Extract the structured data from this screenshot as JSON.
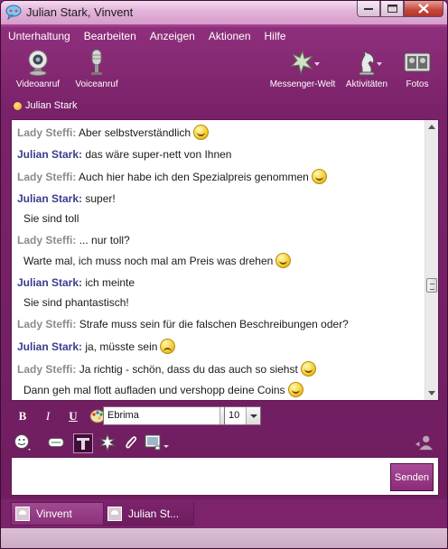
{
  "window": {
    "title": "Julian Stark, Vinvent",
    "accent": "#7a2269"
  },
  "menu": [
    {
      "label": "Unterhaltung"
    },
    {
      "label": "Bearbeiten"
    },
    {
      "label": "Anzeigen"
    },
    {
      "label": "Aktionen"
    },
    {
      "label": "Hilfe"
    }
  ],
  "toolbar": {
    "videocall": {
      "label": "Videoanruf",
      "icon": "webcam-icon"
    },
    "voicecall": {
      "label": "Voiceanruf",
      "icon": "microphone-icon"
    },
    "messenger_world": {
      "label": "Messenger-Welt",
      "icon": "messenger-world-icon"
    },
    "activities": {
      "label": "Aktivitäten",
      "icon": "chess-knight-icon"
    },
    "photos": {
      "label": "Fotos",
      "icon": "photos-icon"
    }
  },
  "contact": {
    "name": "Julian Stark",
    "status_color": "#f3a61c"
  },
  "messages": [
    {
      "sender": "Lady Steffi:",
      "text": "Aber selbstverständlich",
      "smiley": true,
      "who": "steffi"
    },
    {
      "sender": "Julian Stark:",
      "text": "das wäre super-nett von Ihnen",
      "smiley": false,
      "who": "julian"
    },
    {
      "sender": "Lady Steffi:",
      "text": "Auch hier habe ich den Spezialpreis genommen",
      "smiley": true,
      "who": "steffi"
    },
    {
      "sender": "Julian Stark:",
      "text": "super!",
      "cont": "Sie sind toll",
      "smiley": false,
      "who": "julian"
    },
    {
      "sender": "Lady Steffi:",
      "text": "... nur toll?",
      "cont": "Warte mal, ich muss noch mal am Preis was drehen",
      "cont_smiley": true,
      "who": "steffi"
    },
    {
      "sender": "Julian Stark:",
      "text": "ich meinte",
      "cont": "Sie sind phantastisch!",
      "smiley": false,
      "who": "julian"
    },
    {
      "sender": "Lady Steffi:",
      "text": "Strafe muss sein für die falschen Beschreibungen oder?",
      "smiley": false,
      "who": "steffi"
    },
    {
      "sender": "Julian Stark:",
      "text": "ja, müsste sein",
      "smiley": "sad",
      "who": "julian"
    },
    {
      "sender": "Lady Steffi:",
      "text": "Ja richtig - schön, dass du das auch so siehst",
      "smiley": true,
      "cont": "Dann geh mal flott aufladen und vershopp deine Coins",
      "cont_smiley": true,
      "who": "steffi"
    }
  ],
  "format": {
    "bold": "B",
    "italic": "I",
    "underline": "U",
    "font": "Ebrima",
    "size": "10"
  },
  "input": {
    "send_label": "Senden"
  },
  "tabs": [
    {
      "label": "Vinvent"
    },
    {
      "label": "Julian St..."
    }
  ]
}
